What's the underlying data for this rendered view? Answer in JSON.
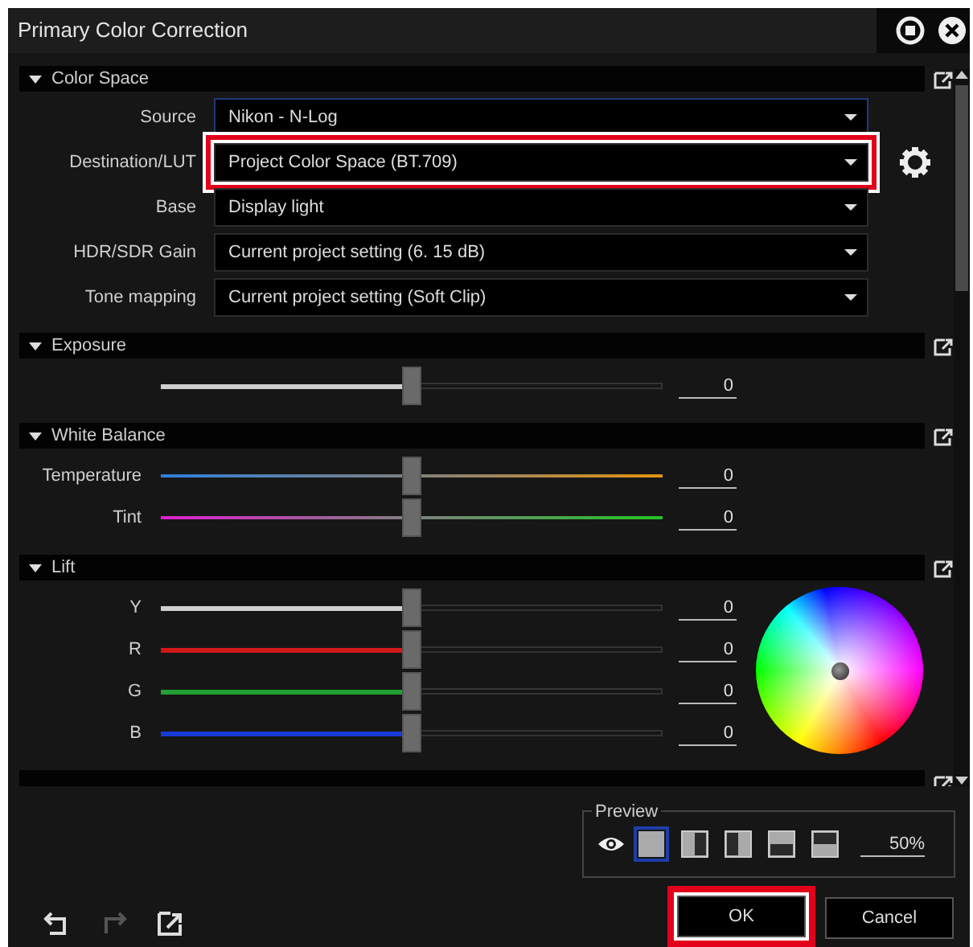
{
  "window": {
    "title": "Primary Color Correction"
  },
  "sections": [
    {
      "kind": "fields",
      "title": "Color Space",
      "expanded": true,
      "fields": [
        {
          "label": "Source",
          "value": "Nikon - N-Log",
          "focused": true,
          "highlighted": false
        },
        {
          "label": "Destination/LUT",
          "value": "Project Color Space (BT.709)",
          "focused": false,
          "highlighted": true,
          "settings": true
        },
        {
          "label": "Base",
          "value": "Display light",
          "focused": false,
          "highlighted": false
        },
        {
          "label": "HDR/SDR Gain",
          "value": "Current project setting (6. 15 dB)",
          "focused": false,
          "highlighted": false
        },
        {
          "label": "Tone mapping",
          "value": "Current project setting (Soft Clip)",
          "focused": false,
          "highlighted": false
        }
      ]
    },
    {
      "kind": "sliders",
      "title": "Exposure",
      "expanded": true,
      "sliders": [
        {
          "level": 0.5,
          "value": "0",
          "color": "#d0d0d0"
        }
      ]
    },
    {
      "kind": "sliders",
      "title": "White Balance",
      "expanded": true,
      "sliders": [
        {
          "label": "Temperature",
          "kind": "temperature",
          "level": 0.5,
          "value": "0"
        },
        {
          "label": "Tint",
          "kind": "tint",
          "level": 0.5,
          "value": "0"
        }
      ]
    },
    {
      "kind": "wheel",
      "title": "Lift",
      "expanded": true,
      "sliders": [
        {
          "label": "Y",
          "level": 0.5,
          "value": "0",
          "color": "#d0d0d0"
        },
        {
          "label": "R",
          "level": 0.5,
          "value": "0",
          "color": "#d01818"
        },
        {
          "label": "G",
          "level": 0.5,
          "value": "0",
          "color": "#22a032"
        },
        {
          "label": "B",
          "level": 0.5,
          "value": "0",
          "color": "#1a3ad8"
        }
      ]
    },
    {
      "kind": "cut"
    }
  ],
  "preview": {
    "title": "Preview",
    "modes": [
      {
        "kind": "full",
        "selected": true
      },
      {
        "kind": "split-left",
        "selected": false
      },
      {
        "kind": "split-right",
        "selected": false
      },
      {
        "kind": "split-top",
        "selected": false
      },
      {
        "kind": "split-bottom",
        "selected": false
      }
    ],
    "value": "50%"
  },
  "footer": {
    "tools": [
      {
        "kind": "undo",
        "disabled": false
      },
      {
        "kind": "redo",
        "disabled": true
      },
      {
        "kind": "export",
        "disabled": false
      }
    ],
    "buttons": [
      {
        "label": "OK",
        "highlighted": true
      },
      {
        "label": "Cancel",
        "highlighted": false
      }
    ]
  }
}
